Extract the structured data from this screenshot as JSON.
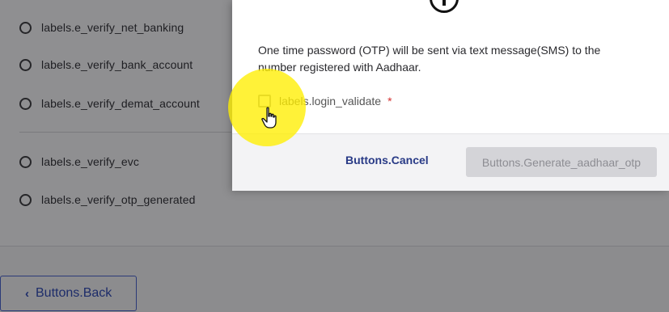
{
  "verify_options": [
    {
      "label": "labels.e_verify_net_banking"
    },
    {
      "label": "labels.e_verify_bank_account"
    },
    {
      "label": "labels.e_verify_demat_account"
    },
    {
      "label": "labels.e_verify_evc"
    },
    {
      "label": "labels.e_verify_otp_generated"
    }
  ],
  "back_button": {
    "label": "Buttons.Back",
    "icon": "chevron-left-icon"
  },
  "modal": {
    "icon": "info-icon",
    "message": "One time password (OTP) will be sent via text message(SMS) to the number registered with Aadhaar.",
    "consent_label": "labels.login_validate",
    "required_marker": "*",
    "cancel_label": "Buttons.Cancel",
    "generate_label": "Buttons.Generate_aadhaar_otp"
  },
  "colors": {
    "overlay": "#8c8c8e",
    "primary": "#283a86",
    "highlight": "#ffee00",
    "required": "#d32f2f"
  }
}
